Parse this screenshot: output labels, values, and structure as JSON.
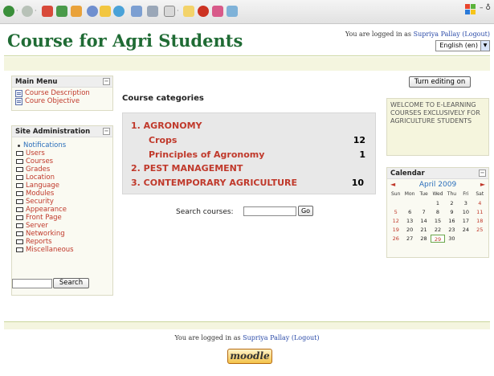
{
  "header": {
    "title": "Course for Agri Students",
    "login_prefix": "You are logged in as",
    "user_name": "Supriya Pallay",
    "logout": "(Logout)",
    "language": "English (en)"
  },
  "main_menu": {
    "title": "Main Menu",
    "items": [
      {
        "label": "Course Description"
      },
      {
        "label": "Coure Objective"
      }
    ]
  },
  "site_admin": {
    "title": "Site Administration",
    "items": [
      {
        "label": "Notifications"
      },
      {
        "label": "Users"
      },
      {
        "label": "Courses"
      },
      {
        "label": "Grades"
      },
      {
        "label": "Location"
      },
      {
        "label": "Language"
      },
      {
        "label": "Modules"
      },
      {
        "label": "Security"
      },
      {
        "label": "Appearance"
      },
      {
        "label": "Front Page"
      },
      {
        "label": "Server"
      },
      {
        "label": "Networking"
      },
      {
        "label": "Reports"
      },
      {
        "label": "Miscellaneous"
      }
    ],
    "search_button": "Search"
  },
  "course_categories": {
    "heading": "Course categories",
    "rows": [
      {
        "label": "1. AGRONOMY",
        "count": "",
        "sub": false
      },
      {
        "label": "Crops",
        "count": "12",
        "sub": true
      },
      {
        "label": "Principles of Agronomy",
        "count": "1",
        "sub": true
      },
      {
        "label": "2. PEST MANAGEMENT",
        "count": "",
        "sub": false
      },
      {
        "label": "3. CONTEMPORARY AGRICULTURE",
        "count": "10",
        "sub": false
      }
    ],
    "search_label": "Search courses:",
    "go_button": "Go"
  },
  "right": {
    "edit_button": "Turn editing on",
    "welcome": "WELCOME TO E-LEARNING COURSES EXCLUSIVELY FOR AGRICULTURE STUDENTS"
  },
  "calendar": {
    "title": "Calendar",
    "month": "April 2009",
    "prev": "◄",
    "next": "►",
    "days": [
      "Sun",
      "Mon",
      "Tue",
      "Wed",
      "Thu",
      "Fri",
      "Sat"
    ],
    "today": "29",
    "weeks": [
      [
        "",
        "",
        "",
        "1",
        "2",
        "3",
        "4"
      ],
      [
        "5",
        "6",
        "7",
        "8",
        "9",
        "10",
        "11"
      ],
      [
        "12",
        "13",
        "14",
        "15",
        "16",
        "17",
        "18"
      ],
      [
        "19",
        "20",
        "21",
        "22",
        "23",
        "24",
        "25"
      ],
      [
        "26",
        "27",
        "28",
        "29",
        "30",
        "",
        ""
      ]
    ]
  },
  "footer": {
    "login_prefix": "You are logged in as",
    "user_name": "Supriya Pallay",
    "logout": "(Logout)",
    "logo_text": "moodle"
  }
}
